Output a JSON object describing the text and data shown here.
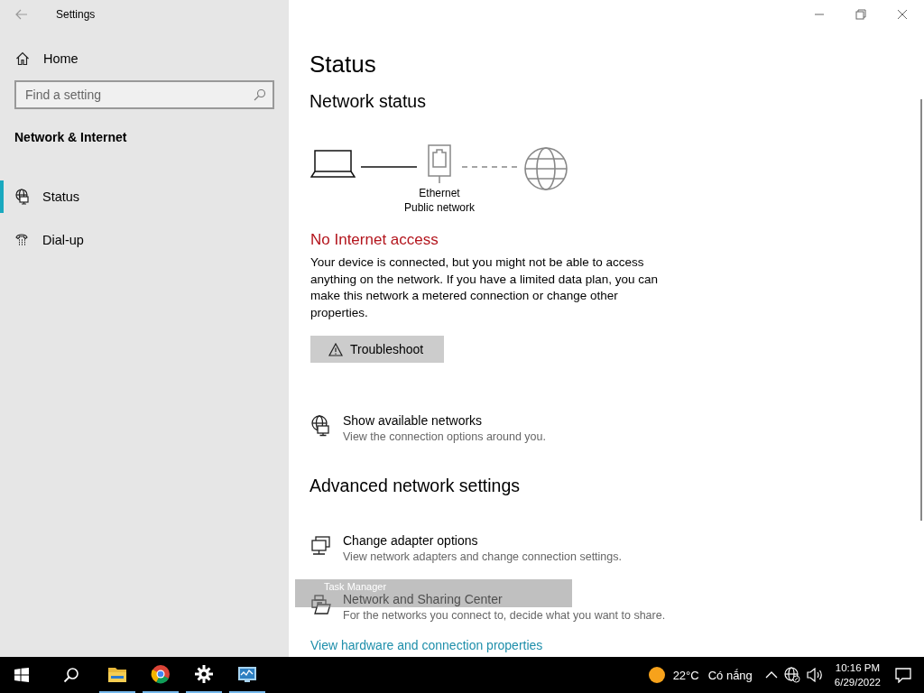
{
  "window": {
    "title": "Settings"
  },
  "sidebar": {
    "home": "Home",
    "search": {
      "placeholder": "Find a setting"
    },
    "section": "Network & Internet",
    "items": [
      {
        "label": "Status",
        "selected": true,
        "kind": "status"
      },
      {
        "label": "Dial-up",
        "selected": false,
        "kind": "dialup"
      }
    ]
  },
  "main": {
    "title": "Status",
    "network_status": {
      "heading": "Network status",
      "adapter": "Ethernet",
      "profile": "Public network",
      "internet_connected": false
    },
    "alert": {
      "title": "No Internet access",
      "text": "Your device is connected, but you might not be able to access anything on the network. If you have a limited data plan, you can make this network a metered connection or change other properties.",
      "button": "Troubleshoot"
    },
    "options": [
      {
        "kind": "networks",
        "title": "Show available networks",
        "subtitle": "View the connection options around you."
      }
    ],
    "advanced": {
      "heading": "Advanced network settings",
      "items": [
        {
          "kind": "adapter",
          "title": "Change adapter options",
          "subtitle": "View network adapters and change connection settings."
        },
        {
          "kind": "sharing",
          "title": "Network and Sharing Center",
          "subtitle": "For the networks you connect to, decide what you want to share."
        }
      ],
      "link": "View hardware and connection properties"
    }
  },
  "tooltip": {
    "text": "Task Manager"
  },
  "taskbar": {
    "apps": [
      {
        "kind": "explorer",
        "running": true
      },
      {
        "kind": "browser",
        "running": true
      },
      {
        "kind": "settings",
        "running": true
      },
      {
        "kind": "taskmanager",
        "running": true
      }
    ],
    "weather": {
      "temp": "22°C",
      "condition": "Có nắng"
    },
    "time": "10:16 PM",
    "date": "6/29/2022"
  }
}
